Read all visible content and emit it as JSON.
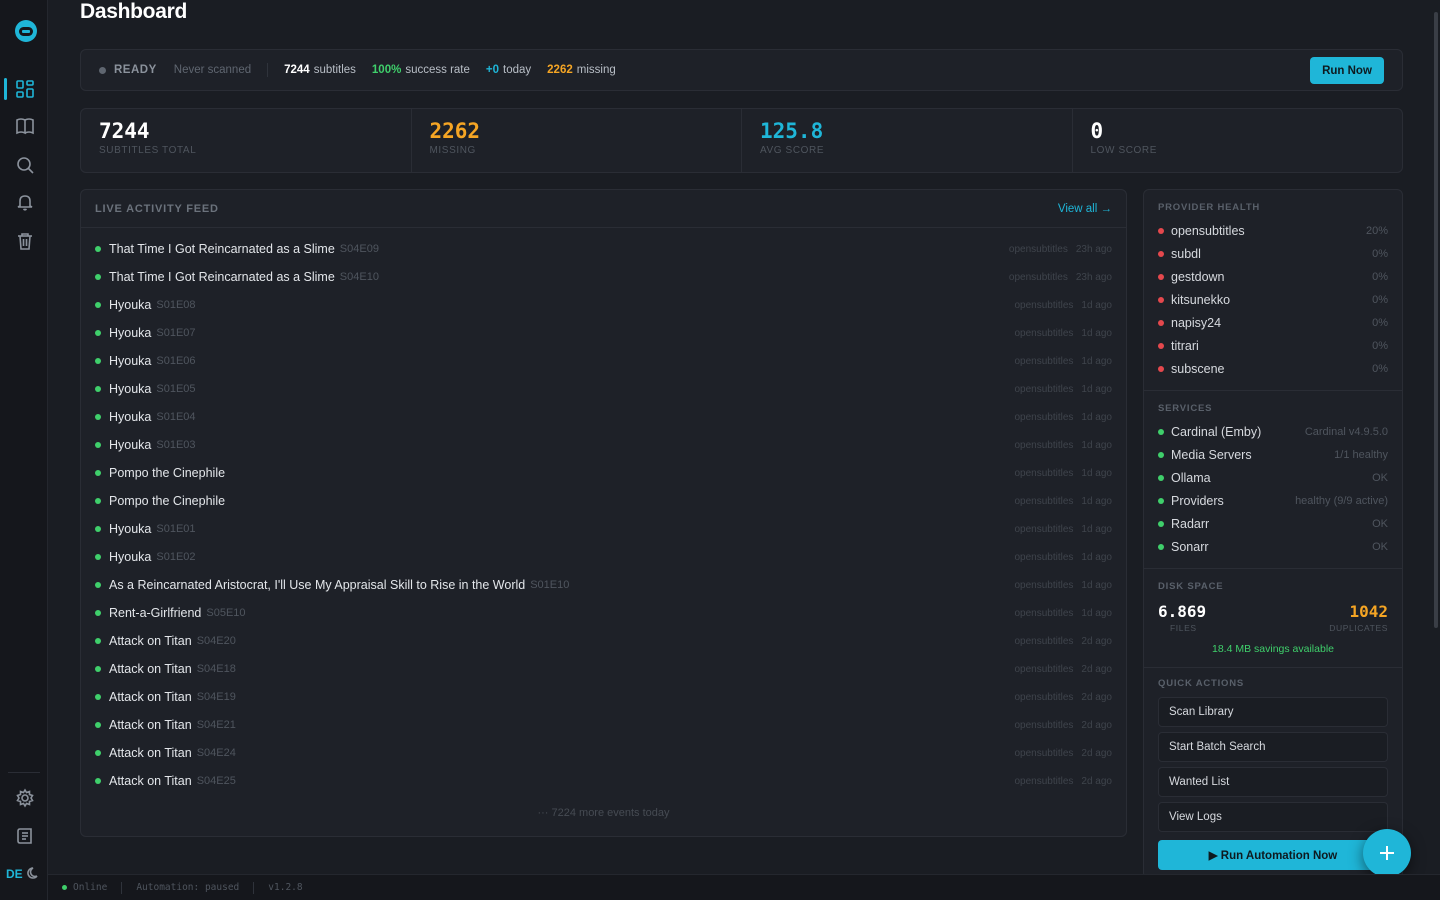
{
  "app": {
    "page_title": "Dashboard",
    "language": "DE"
  },
  "colors": {
    "accent": "#1fb6d8",
    "success": "#3fcf6b",
    "warning": "#f5a524",
    "error": "#e5484d"
  },
  "sidebar": {
    "items": [
      {
        "name": "dashboard",
        "icon": "dashboard-icon",
        "active": true
      },
      {
        "name": "library",
        "icon": "book-icon"
      },
      {
        "name": "search",
        "icon": "search-icon"
      },
      {
        "name": "notifications",
        "icon": "bell-icon"
      },
      {
        "name": "trash",
        "icon": "trash-icon"
      }
    ],
    "bottom": [
      {
        "name": "settings",
        "icon": "gear-icon"
      },
      {
        "name": "logs",
        "icon": "log-icon"
      }
    ]
  },
  "status": {
    "state": "READY",
    "last_scan": "Never scanned",
    "subtitles_count": "7244",
    "subtitles_label": "subtitles",
    "success_rate": "100%",
    "success_label": "success rate",
    "today": "+0",
    "today_label": "today",
    "missing": "2262",
    "missing_label": "missing",
    "run_button": "Run Now"
  },
  "stats": [
    {
      "value": "7244",
      "label": "SUBTITLES TOTAL",
      "color": "#ffffff"
    },
    {
      "value": "2262",
      "label": "MISSING",
      "color": "#f5a524"
    },
    {
      "value": "125.8",
      "label": "AVG SCORE",
      "color": "#1fb6d8"
    },
    {
      "value": "0",
      "label": "LOW SCORE",
      "color": "#ffffff"
    }
  ],
  "feed": {
    "title": "LIVE ACTIVITY FEED",
    "view_all": "View all →",
    "more": "··· 7224 more events today",
    "items": [
      {
        "title": "That Time I Got Reincarnated as a Slime",
        "episode": "S04E09",
        "provider": "opensubtitles",
        "time": "23h ago"
      },
      {
        "title": "That Time I Got Reincarnated as a Slime",
        "episode": "S04E10",
        "provider": "opensubtitles",
        "time": "23h ago"
      },
      {
        "title": "Hyouka",
        "episode": "S01E08",
        "provider": "opensubtitles",
        "time": "1d ago"
      },
      {
        "title": "Hyouka",
        "episode": "S01E07",
        "provider": "opensubtitles",
        "time": "1d ago"
      },
      {
        "title": "Hyouka",
        "episode": "S01E06",
        "provider": "opensubtitles",
        "time": "1d ago"
      },
      {
        "title": "Hyouka",
        "episode": "S01E05",
        "provider": "opensubtitles",
        "time": "1d ago"
      },
      {
        "title": "Hyouka",
        "episode": "S01E04",
        "provider": "opensubtitles",
        "time": "1d ago"
      },
      {
        "title": "Hyouka",
        "episode": "S01E03",
        "provider": "opensubtitles",
        "time": "1d ago"
      },
      {
        "title": "Pompo the Cinephile",
        "episode": "",
        "provider": "opensubtitles",
        "time": "1d ago"
      },
      {
        "title": "Pompo the Cinephile",
        "episode": "",
        "provider": "opensubtitles",
        "time": "1d ago"
      },
      {
        "title": "Hyouka",
        "episode": "S01E01",
        "provider": "opensubtitles",
        "time": "1d ago"
      },
      {
        "title": "Hyouka",
        "episode": "S01E02",
        "provider": "opensubtitles",
        "time": "1d ago"
      },
      {
        "title": "As a Reincarnated Aristocrat, I'll Use My Appraisal Skill to Rise in the World",
        "episode": "S01E10",
        "provider": "opensubtitles",
        "time": "1d ago"
      },
      {
        "title": "Rent-a-Girlfriend",
        "episode": "S05E10",
        "provider": "opensubtitles",
        "time": "1d ago"
      },
      {
        "title": "Attack on Titan",
        "episode": "S04E20",
        "provider": "opensubtitles",
        "time": "2d ago"
      },
      {
        "title": "Attack on Titan",
        "episode": "S04E18",
        "provider": "opensubtitles",
        "time": "2d ago"
      },
      {
        "title": "Attack on Titan",
        "episode": "S04E19",
        "provider": "opensubtitles",
        "time": "2d ago"
      },
      {
        "title": "Attack on Titan",
        "episode": "S04E21",
        "provider": "opensubtitles",
        "time": "2d ago"
      },
      {
        "title": "Attack on Titan",
        "episode": "S04E24",
        "provider": "opensubtitles",
        "time": "2d ago"
      },
      {
        "title": "Attack on Titan",
        "episode": "S04E25",
        "provider": "opensubtitles",
        "time": "2d ago"
      }
    ]
  },
  "provider_health": {
    "title": "PROVIDER HEALTH",
    "items": [
      {
        "name": "opensubtitles",
        "value": "20%",
        "status": "error"
      },
      {
        "name": "subdl",
        "value": "0%",
        "status": "error"
      },
      {
        "name": "gestdown",
        "value": "0%",
        "status": "error"
      },
      {
        "name": "kitsunekko",
        "value": "0%",
        "status": "error"
      },
      {
        "name": "napisy24",
        "value": "0%",
        "status": "error"
      },
      {
        "name": "titrari",
        "value": "0%",
        "status": "error"
      },
      {
        "name": "subscene",
        "value": "0%",
        "status": "error"
      }
    ]
  },
  "services": {
    "title": "SERVICES",
    "items": [
      {
        "name": "Cardinal (Emby)",
        "value": "Cardinal v4.9.5.0",
        "status": "ok"
      },
      {
        "name": "Media Servers",
        "value": "1/1 healthy",
        "status": "ok"
      },
      {
        "name": "Ollama",
        "value": "OK",
        "status": "ok"
      },
      {
        "name": "Providers",
        "value": "healthy (9/9 active)",
        "status": "ok"
      },
      {
        "name": "Radarr",
        "value": "OK",
        "status": "ok"
      },
      {
        "name": "Sonarr",
        "value": "OK",
        "status": "ok"
      }
    ]
  },
  "disk": {
    "title": "DISK SPACE",
    "files": "6.869",
    "files_label": "FILES",
    "duplicates": "1042",
    "duplicates_label": "DUPLICATES",
    "savings": "18.4 MB savings available"
  },
  "quick_actions": {
    "title": "QUICK ACTIONS",
    "buttons": [
      "Scan Library",
      "Start Batch Search",
      "Wanted List",
      "View Logs"
    ],
    "automation": "▶ Run Automation Now"
  },
  "footer": {
    "online": "Online",
    "automation": "Automation: paused",
    "version": "v1.2.8"
  }
}
